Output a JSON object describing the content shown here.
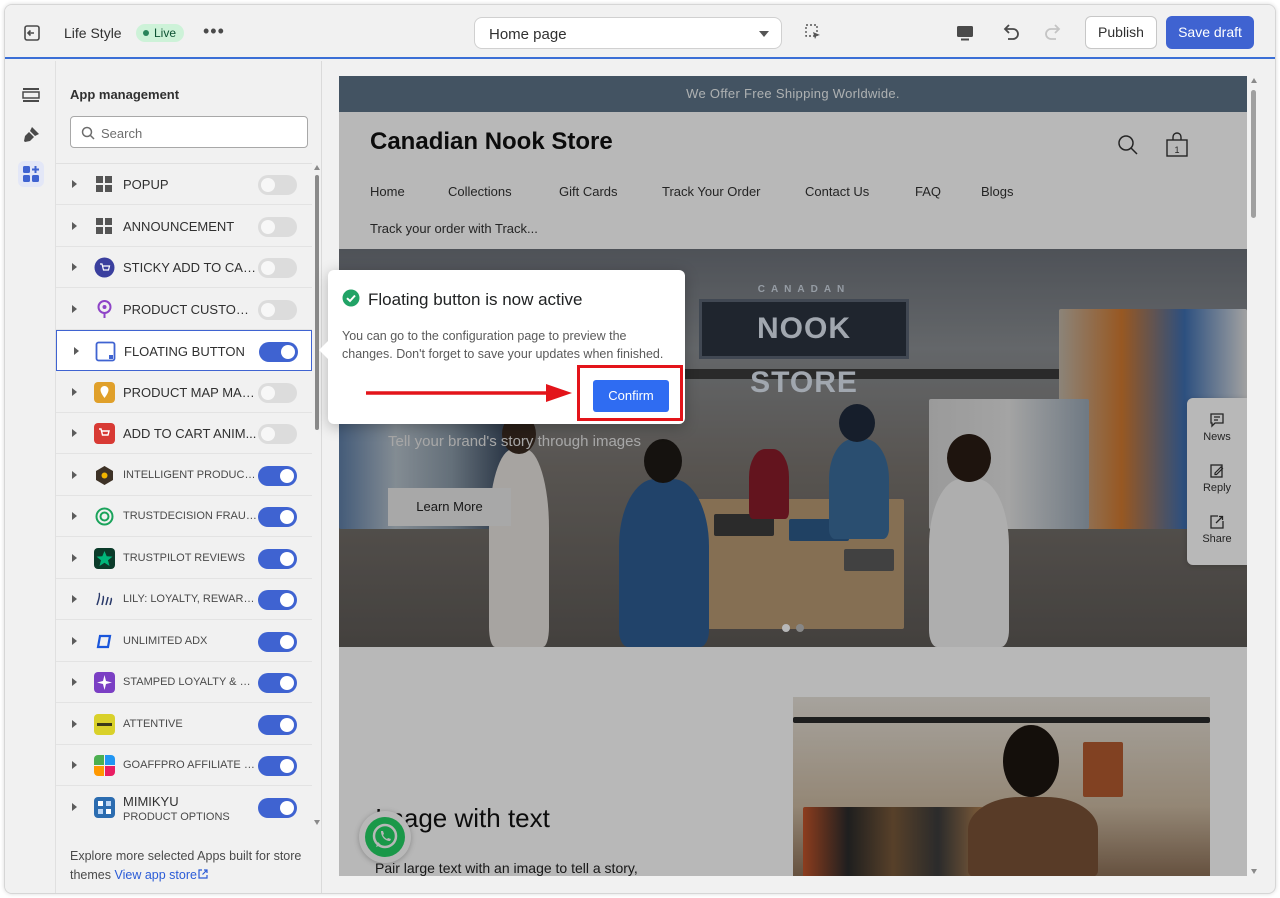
{
  "topbar": {
    "store_name": "Life Style",
    "live_label": "Live",
    "more_label": "•••",
    "page_selector": "Home page",
    "publish_label": "Publish",
    "save_label": "Save draft"
  },
  "sidebar": {
    "title": "App management",
    "search_placeholder": "Search",
    "items": [
      {
        "label": "POPUP",
        "icon": "grid-icon",
        "enabled": false
      },
      {
        "label": "ANNOUNCEMENT",
        "icon": "grid-icon",
        "enabled": false
      },
      {
        "label": "STICKY ADD TO CAR...",
        "icon": "cart-circle-icon",
        "enabled": false
      },
      {
        "label": "PRODUCT CUSTOMIZ...",
        "icon": "customize-icon",
        "enabled": false
      },
      {
        "label": "FLOATING BUTTON",
        "icon": "floating-button-icon",
        "enabled": true
      },
      {
        "label": "PRODUCT MAP MAR...",
        "icon": "map-marker-icon",
        "enabled": false
      },
      {
        "label": "ADD TO CART ANIM...",
        "icon": "cart-animation-icon",
        "enabled": false
      },
      {
        "label": "INTELLIGENT PRODUCT R...",
        "icon": "intelligent-product-icon",
        "enabled": true
      },
      {
        "label": "TRUSTDECISION FRAUD P...",
        "icon": "trustdecision-icon",
        "enabled": true
      },
      {
        "label": "TRUSTPILOT REVIEWS",
        "icon": "trustpilot-star-icon",
        "enabled": true
      },
      {
        "label": "LILY: LOYALTY, REWARDS, ...",
        "icon": "lily-logo-icon",
        "enabled": true
      },
      {
        "label": "UNLIMITED ADX",
        "icon": "adx-icon",
        "enabled": true
      },
      {
        "label": "STAMPED LOYALTY & REF...",
        "icon": "stamped-icon",
        "enabled": true
      },
      {
        "label": "ATTENTIVE",
        "icon": "attentive-icon",
        "enabled": true
      },
      {
        "label": "GOAFFPRO AFFILIATE MA...",
        "icon": "goaffpro-icon",
        "enabled": true
      },
      {
        "label": "MIMIKYU",
        "sublabel": "PRODUCT OPTIONS",
        "icon": "mimikyu-icon",
        "enabled": true
      }
    ],
    "explore_text": "Explore more selected Apps built for store themes",
    "explore_link": "View app store"
  },
  "preview": {
    "announcement": "We Offer Free Shipping Worldwide.",
    "brand": "Canadian Nook Store",
    "cart_count": "1",
    "nav": [
      "Home",
      "Collections",
      "Gift Cards",
      "Track Your Order",
      "Contact Us",
      "FAQ",
      "Blogs"
    ],
    "nav_second_line": "Track your order with Track...",
    "hero_sign": "NOOK STORE",
    "hero_sign_top": "CANADAN",
    "hero_subtitle": "Tell your brand's story through images",
    "hero_button": "Learn More",
    "image_with_text_title": "Image with text",
    "image_with_text_body": "Pair large text with an image to tell a story,",
    "side_widget": [
      "News",
      "Reply",
      "Share"
    ]
  },
  "popup": {
    "title": "Floating button is now active",
    "body": "You can go to the configuration page to preview the changes. Don't forget to save your updates when finished.",
    "confirm_label": "Confirm"
  },
  "colors": {
    "accent": "#3f63d1",
    "confirm": "#2f6cf2",
    "highlight": "#e3141a",
    "announcement_bar": "#5d7488"
  }
}
